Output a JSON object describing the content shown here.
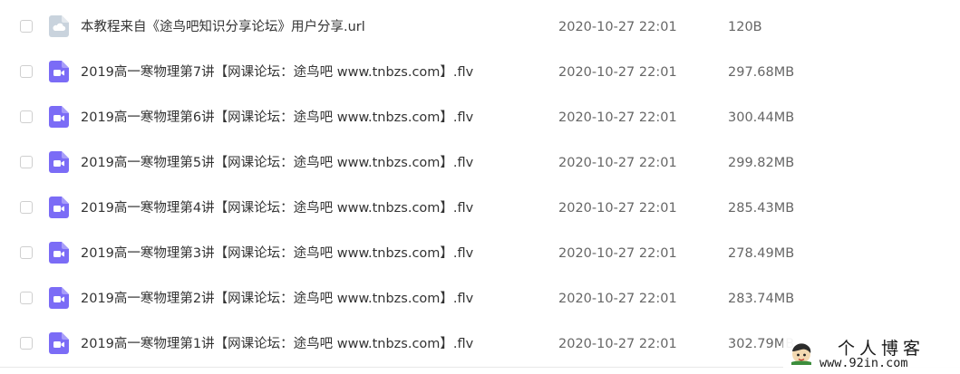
{
  "files": [
    {
      "type": "url",
      "icon": "cloud-file-icon",
      "name": "本教程来自《途鸟吧知识分享论坛》用户分享.url",
      "date": "2020-10-27 22:01",
      "size": "120B"
    },
    {
      "type": "video",
      "icon": "video-file-icon",
      "name": "2019高一寒物理第7讲【网课论坛：途鸟吧 www.tnbzs.com】.flv",
      "date": "2020-10-27 22:01",
      "size": "297.68MB"
    },
    {
      "type": "video",
      "icon": "video-file-icon",
      "name": "2019高一寒物理第6讲【网课论坛：途鸟吧 www.tnbzs.com】.flv",
      "date": "2020-10-27 22:01",
      "size": "300.44MB"
    },
    {
      "type": "video",
      "icon": "video-file-icon",
      "name": "2019高一寒物理第5讲【网课论坛：途鸟吧 www.tnbzs.com】.flv",
      "date": "2020-10-27 22:01",
      "size": "299.82MB"
    },
    {
      "type": "video",
      "icon": "video-file-icon",
      "name": "2019高一寒物理第4讲【网课论坛：途鸟吧 www.tnbzs.com】.flv",
      "date": "2020-10-27 22:01",
      "size": "285.43MB"
    },
    {
      "type": "video",
      "icon": "video-file-icon",
      "name": "2019高一寒物理第3讲【网课论坛：途鸟吧 www.tnbzs.com】.flv",
      "date": "2020-10-27 22:01",
      "size": "278.49MB"
    },
    {
      "type": "video",
      "icon": "video-file-icon",
      "name": "2019高一寒物理第2讲【网课论坛：途鸟吧 www.tnbzs.com】.flv",
      "date": "2020-10-27 22:01",
      "size": "283.74MB"
    },
    {
      "type": "video",
      "icon": "video-file-icon",
      "name": "2019高一寒物理第1讲【网课论坛：途鸟吧 www.tnbzs.com】.flv",
      "date": "2020-10-27 22:01",
      "size": "302.79MB"
    }
  ],
  "watermark": {
    "title": "个人博客",
    "url": "www.92in.com"
  },
  "colors": {
    "video_icon": "#7b6cf6",
    "url_icon": "#c9d3dd"
  }
}
